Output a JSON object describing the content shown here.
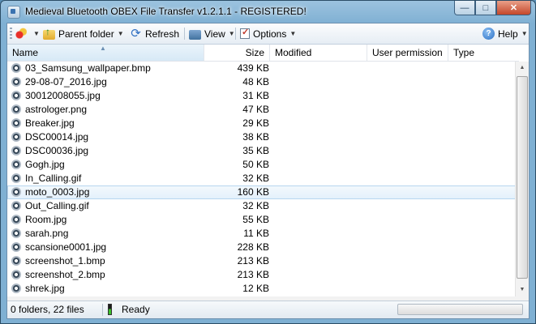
{
  "window": {
    "title": "Medieval Bluetooth OBEX File Transfer v1.2.1.1 - REGISTERED!",
    "controls": {
      "minimize": "—",
      "maximize": "□",
      "close": "✕"
    }
  },
  "toolbar": {
    "connect_caret": "▼",
    "parent_folder": "Parent folder",
    "refresh": "Refresh",
    "view": "View",
    "options": "Options",
    "help": "Help",
    "caret": "▼",
    "help_icon_glyph": "?"
  },
  "columns": {
    "name": "Name",
    "size": "Size",
    "modified": "Modified",
    "user_permission": "User permission",
    "type": "Type",
    "sort_indicator": "▲"
  },
  "files": [
    {
      "name": "03_Samsung_wallpaper.bmp",
      "size": "439 KB"
    },
    {
      "name": "29-08-07_2016.jpg",
      "size": "48 KB"
    },
    {
      "name": "30012008055.jpg",
      "size": "31 KB"
    },
    {
      "name": "astrologer.png",
      "size": "47 KB"
    },
    {
      "name": "Breaker.jpg",
      "size": "29 KB"
    },
    {
      "name": "DSC00014.jpg",
      "size": "38 KB"
    },
    {
      "name": "DSC00036.jpg",
      "size": "35 KB"
    },
    {
      "name": "Gogh.jpg",
      "size": "50 KB"
    },
    {
      "name": "In_Calling.gif",
      "size": "32 KB"
    },
    {
      "name": "moto_0003.jpg",
      "size": "160 KB",
      "selected": true
    },
    {
      "name": "Out_Calling.gif",
      "size": "32 KB"
    },
    {
      "name": "Room.jpg",
      "size": "55 KB"
    },
    {
      "name": "sarah.png",
      "size": "11 KB"
    },
    {
      "name": "scansione0001.jpg",
      "size": "228 KB"
    },
    {
      "name": "screenshot_1.bmp",
      "size": "213 KB"
    },
    {
      "name": "screenshot_2.bmp",
      "size": "213 KB"
    },
    {
      "name": "shrek.jpg",
      "size": "12 KB"
    }
  ],
  "scrollbar": {
    "up": "▲",
    "down": "▼"
  },
  "status": {
    "count": "0 folders, 22 files",
    "state": "Ready"
  },
  "colors": {
    "selection": "#e2f0fb",
    "sorted_header": "#d7e9f6",
    "ready_lamp": "#3bc12a"
  },
  "icons": {
    "app": "bluetooth-app-icon",
    "connect": "connect-icon",
    "parent_folder": "folder-up-icon",
    "refresh": "refresh-icon",
    "view": "view-icon",
    "options": "options-checkbox-icon",
    "help": "help-icon",
    "file": "file-disc-icon"
  }
}
